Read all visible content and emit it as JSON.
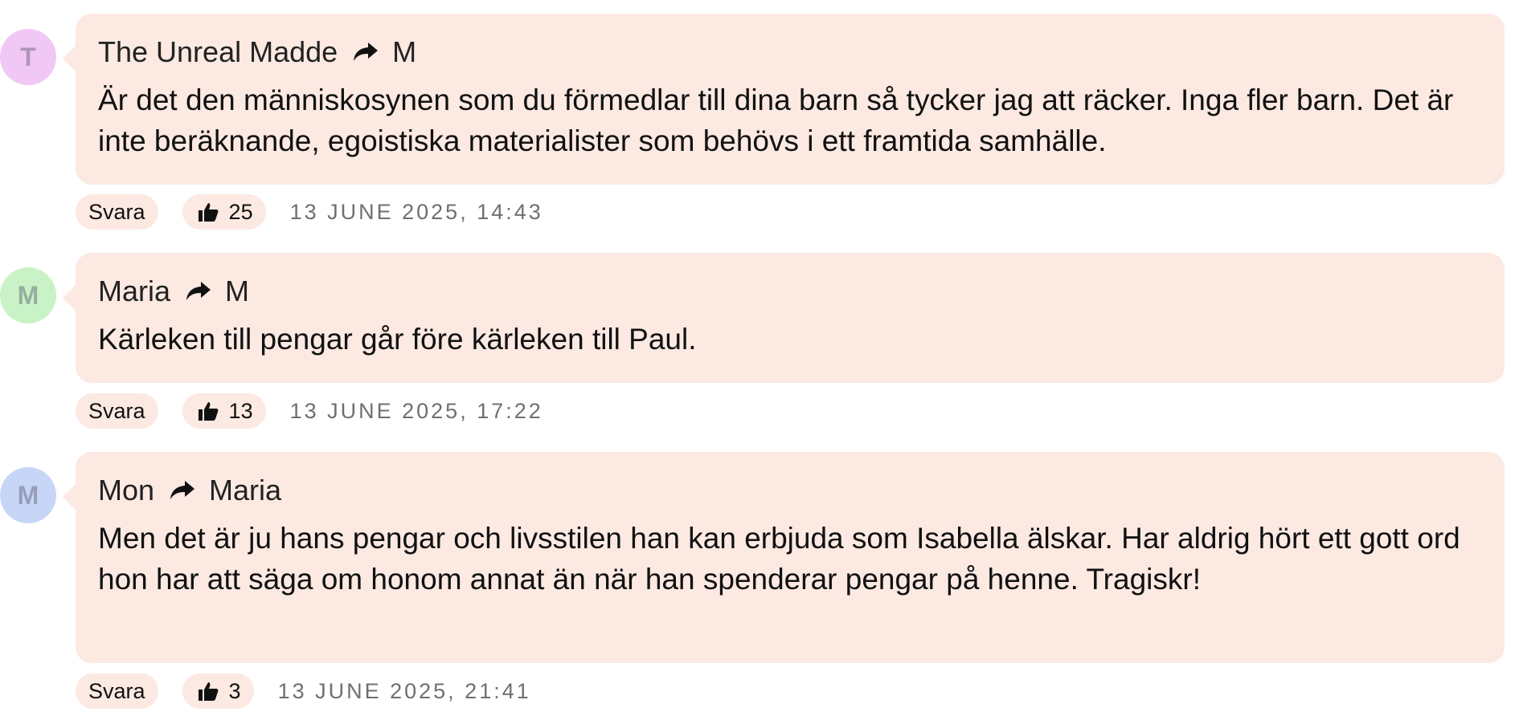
{
  "comments": [
    {
      "avatar_letter": "T",
      "avatar_color": "#f1c8f5",
      "author": "The Unreal Madde",
      "reply_to": "M",
      "text": "Är det den människosynen som du förmedlar till dina barn så tycker jag att räcker. Inga fler barn. Det är inte beräknande, egoistiska materialister som behövs i ett framtida samhälle.",
      "reply_label": "Svara",
      "likes": "25",
      "timestamp": "13 JUNE 2025, 14:43"
    },
    {
      "avatar_letter": "M",
      "avatar_color": "#c9f3c6",
      "author": "Maria",
      "reply_to": "M",
      "text": "Kärleken till pengar går före kärleken till Paul.",
      "reply_label": "Svara",
      "likes": "13",
      "timestamp": "13 JUNE 2025, 17:22"
    },
    {
      "avatar_letter": "M",
      "avatar_color": "#c7d6f7",
      "author": "Mon",
      "reply_to": "Maria",
      "text": "Men det är ju hans pengar och livsstilen han kan erbjuda som Isabella älskar. Har aldrig hört ett gott ord hon har att säga om honom annat än när han spenderar pengar på henne. Tragiskr!",
      "reply_label": "Svara",
      "likes": "3",
      "timestamp": "13 JUNE 2025, 21:41"
    }
  ],
  "icons": {
    "reply_arrow": "reply-arrow-icon",
    "like": "thumbs-up-icon"
  },
  "colors": {
    "bubble_bg": "#fbe9e2",
    "timestamp": "#6f6f6f"
  }
}
